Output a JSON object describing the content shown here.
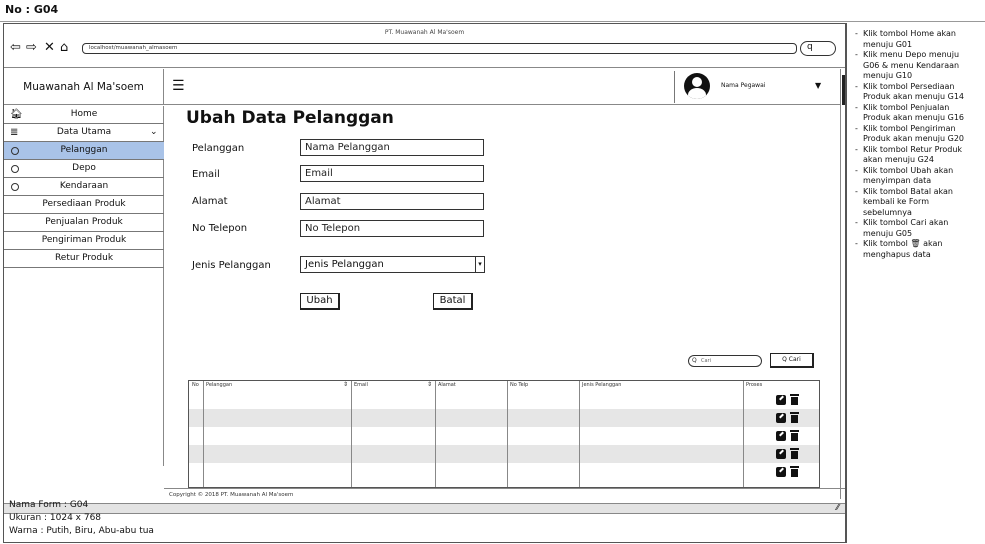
{
  "doc": {
    "number": "No : G04",
    "meta_form": "Nama Form : G04",
    "meta_size": "Ukuran : 1024 x 768",
    "meta_color": "Warna : Putih, Biru, Abu-abu tua"
  },
  "browser": {
    "title": "PT. Muawanah Al Ma'soem",
    "url": "localhost/muawanah_almasoem",
    "icons": [
      "back-icon",
      "forward-icon",
      "close-icon",
      "home-icon",
      "search-icon"
    ]
  },
  "app": {
    "brand": "Muawanah Al Ma'soem",
    "user_name": "Nama Pegawai"
  },
  "sidebar": {
    "items": [
      {
        "label": "Home",
        "icon": "home-icon"
      },
      {
        "label": "Data Utama",
        "icon": "database-icon"
      },
      {
        "label": "Pelanggan",
        "icon": "radio-icon",
        "active": true
      },
      {
        "label": "Depo",
        "icon": "radio-icon"
      },
      {
        "label": "Kendaraan",
        "icon": "radio-icon"
      },
      {
        "label": "Persediaan Produk"
      },
      {
        "label": "Penjualan Produk"
      },
      {
        "label": "Pengiriman Produk"
      },
      {
        "label": "Retur Produk"
      }
    ]
  },
  "form": {
    "title": "Ubah Data Pelanggan",
    "fields": [
      {
        "label": "Pelanggan",
        "placeholder": "Nama Pelanggan"
      },
      {
        "label": "Email",
        "placeholder": "Email"
      },
      {
        "label": "Alamat",
        "placeholder": "Alamat"
      },
      {
        "label": "No Telepon",
        "placeholder": "No Telepon"
      },
      {
        "label": "Jenis Pelanggan",
        "placeholder": "Jenis Pelanggan"
      }
    ],
    "submit_label": "Ubah",
    "cancel_label": "Batal"
  },
  "table": {
    "search_placeholder": "Cari",
    "search_button": "Q Cari",
    "columns": [
      "No",
      "Pelanggan",
      "Email",
      "Alamat",
      "No Telp",
      "Jenis Pelanggan",
      "Proses"
    ],
    "row_count": 5
  },
  "footer": {
    "copyright": "Copyright © 2018 PT. Muawanah Al Ma'soem"
  },
  "notes": [
    "Klik tombol Home akan",
    "menuju G01",
    "Klik menu Depo menuju",
    "G06 & menu Kendaraan",
    "menuju G10",
    "Klik tombol Persediaan",
    "Produk akan menuju G14",
    "Klik tombol Penjualan",
    "Produk akan menuju G16",
    "Klik tombol Pengiriman",
    "Produk akan menuju G20",
    "Klik tombol Retur Produk",
    "akan menuju G24",
    "Klik tombol Ubah akan",
    "menyimpan data",
    "Klik tombol Batal akan",
    "kembali ke Form",
    "sebelumnya",
    "Klik tombol Cari akan",
    "menuju G05",
    "Klik tombol 🗑 akan",
    "menghapus data"
  ]
}
